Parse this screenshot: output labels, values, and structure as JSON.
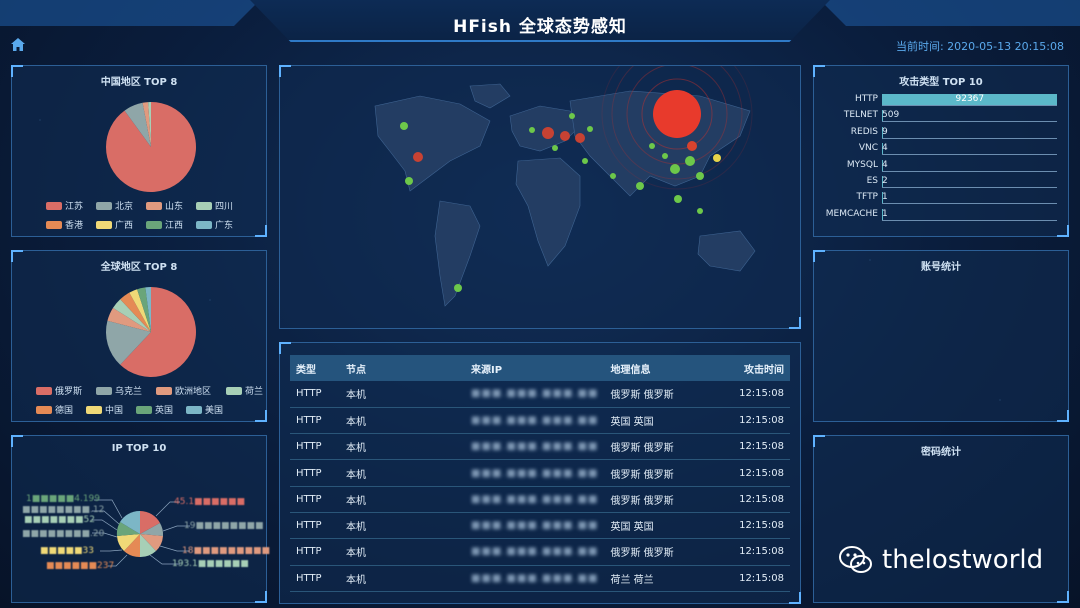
{
  "header": {
    "title": "HFish 全球态势感知",
    "clock_label": "当前时间:",
    "clock_value": "2020-05-13 20:15:08"
  },
  "china_top8": {
    "title": "中国地区 TOP 8",
    "legend": [
      {
        "label": "江苏",
        "color": "#d96d66"
      },
      {
        "label": "北京",
        "color": "#8fa6a8"
      },
      {
        "label": "山东",
        "color": "#e09a7f"
      },
      {
        "label": "四川",
        "color": "#a7cfb6"
      },
      {
        "label": "香港",
        "color": "#e58a55"
      },
      {
        "label": "广西",
        "color": "#f0d977"
      },
      {
        "label": "江西",
        "color": "#6aa57a"
      },
      {
        "label": "广东",
        "color": "#7cb6c6"
      }
    ],
    "slices": [
      {
        "label": "江苏",
        "value": 90
      },
      {
        "label": "北京",
        "value": 7
      },
      {
        "label": "山东",
        "value": 2
      },
      {
        "label": "四川",
        "value": 1
      }
    ]
  },
  "global_top8": {
    "title": "全球地区 TOP 8",
    "legend": [
      {
        "label": "俄罗斯",
        "color": "#d96d66"
      },
      {
        "label": "乌克兰",
        "color": "#8fa6a8"
      },
      {
        "label": "欧洲地区",
        "color": "#e09a7f"
      },
      {
        "label": "荷兰",
        "color": "#a7cfb6"
      },
      {
        "label": "德国",
        "color": "#e58a55"
      },
      {
        "label": "中国",
        "color": "#f0d977"
      },
      {
        "label": "英国",
        "color": "#6aa57a"
      },
      {
        "label": "美国",
        "color": "#7cb6c6"
      }
    ],
    "slices": [
      {
        "label": "俄罗斯",
        "value": 62
      },
      {
        "label": "乌克兰",
        "value": 17
      },
      {
        "label": "欧洲地区",
        "value": 5
      },
      {
        "label": "荷兰",
        "value": 4
      },
      {
        "label": "德国",
        "value": 4
      },
      {
        "label": "中国",
        "value": 3
      },
      {
        "label": "英国",
        "value": 3
      },
      {
        "label": "美国",
        "value": 2
      }
    ]
  },
  "ip_top10": {
    "title": "IP TOP 10",
    "labels_left": [
      "1■■■■■4.199",
      "■■■■■■■■.12",
      "■■■■■■■52",
      "■■■■■■■■.20",
      "■■■■■33",
      "■■■■■■237"
    ],
    "labels_right": [
      "45.1■■■■■■",
      "19■■■■■■■■",
      "18■■■■■■■■■",
      "193.1■■■■■■"
    ]
  },
  "attack_types": {
    "title": "攻击类型 TOP 10",
    "items": [
      {
        "label": "HTTP",
        "value": "92367",
        "ratio": 1.0
      },
      {
        "label": "TELNET",
        "value": "509",
        "ratio": 0.006
      },
      {
        "label": "REDIS",
        "value": "9",
        "ratio": 0.0
      },
      {
        "label": "VNC",
        "value": "4",
        "ratio": 0.0
      },
      {
        "label": "MYSQL",
        "value": "4",
        "ratio": 0.0
      },
      {
        "label": "ES",
        "value": "2",
        "ratio": 0.0
      },
      {
        "label": "TFTP",
        "value": "1",
        "ratio": 0.0
      },
      {
        "label": "MEMCACHE",
        "value": "1",
        "ratio": 0.0
      }
    ]
  },
  "account_stats": {
    "title": "账号统计"
  },
  "password_stats": {
    "title": "密码统计"
  },
  "log_table": {
    "headers": [
      "类型",
      "节点",
      "来源IP",
      "地理信息",
      "攻击时间"
    ],
    "rows": [
      [
        "HTTP",
        "本机",
        "■■■.■■■.■■■.■■",
        "俄罗斯 俄罗斯",
        "12:15:08"
      ],
      [
        "HTTP",
        "本机",
        "■■■.■■■.■■■.■■",
        "英国 英国",
        "12:15:08"
      ],
      [
        "HTTP",
        "本机",
        "■■■.■■■.■■■.■■",
        "俄罗斯 俄罗斯",
        "12:15:08"
      ],
      [
        "HTTP",
        "本机",
        "■■■.■■■.■■■.■■",
        "俄罗斯 俄罗斯",
        "12:15:08"
      ],
      [
        "HTTP",
        "本机",
        "■■■.■■■.■■■.■■",
        "俄罗斯 俄罗斯",
        "12:15:08"
      ],
      [
        "HTTP",
        "本机",
        "■■■.■■■.■■■.■■",
        "英国 英国",
        "12:15:08"
      ],
      [
        "HTTP",
        "本机",
        "■■■.■■■.■■■.■■",
        "俄罗斯 俄罗斯",
        "12:15:08"
      ],
      [
        "HTTP",
        "本机",
        "■■■.■■■.■■■.■■",
        "荷兰 荷兰",
        "12:15:08"
      ]
    ]
  },
  "watermark": {
    "text": "thelostworld",
    "icon": "wechat-icon"
  }
}
